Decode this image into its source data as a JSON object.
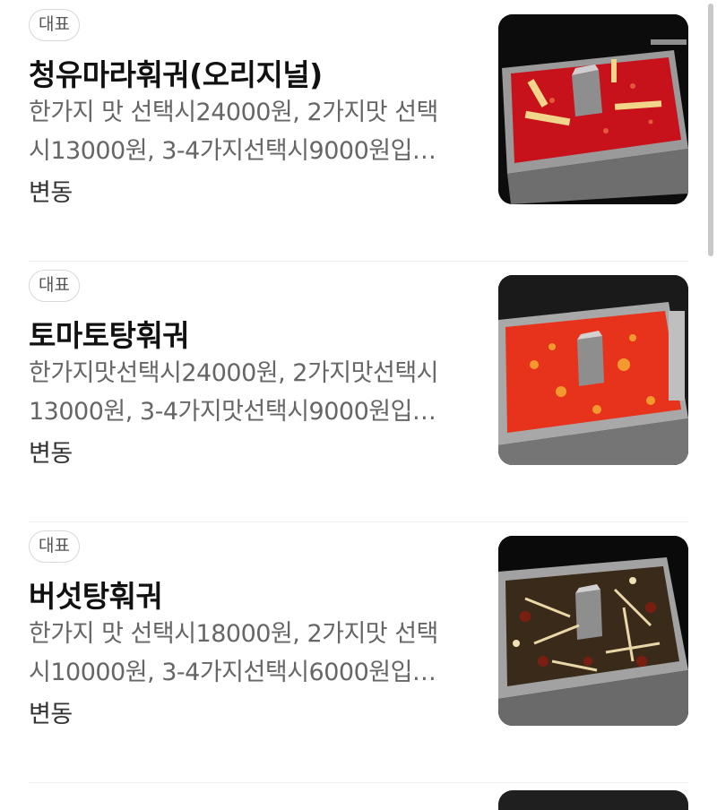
{
  "menu": {
    "items": [
      {
        "badge": "대표",
        "name": "청유마라훠궈(오리지널)",
        "desc_line1": "한가지 맛 선택시24000원, 2가지맛 선택",
        "desc_line2": "시13000원, 3-4가지선택시9000원입…",
        "extra": "변동",
        "image": "hotpot-mala-oil-photo"
      },
      {
        "badge": "대표",
        "name": "토마토탕훠궈",
        "desc_line1": "한가지맛선택시24000원, 2가지맛선택시",
        "desc_line2": "13000원, 3-4가지맛선택시9000원입…",
        "extra": "변동",
        "image": "hotpot-tomato-broth-photo"
      },
      {
        "badge": "대표",
        "name": "버섯탕훠궈",
        "desc_line1": "한가지 맛 선택시18000원, 2가지맛 선택",
        "desc_line2": "시10000원, 3-4가지선택시6000원입…",
        "extra": "변동",
        "image": "hotpot-mushroom-broth-photo"
      }
    ]
  },
  "colors": {
    "badge_border": "#d8d8d8",
    "text_primary": "#111111",
    "text_secondary": "#666666",
    "broth_red": "#c8121b",
    "broth_tomato": "#e8331c",
    "broth_mushroom": "#3a2a1a",
    "pot_steel": "#b9b9b9"
  }
}
